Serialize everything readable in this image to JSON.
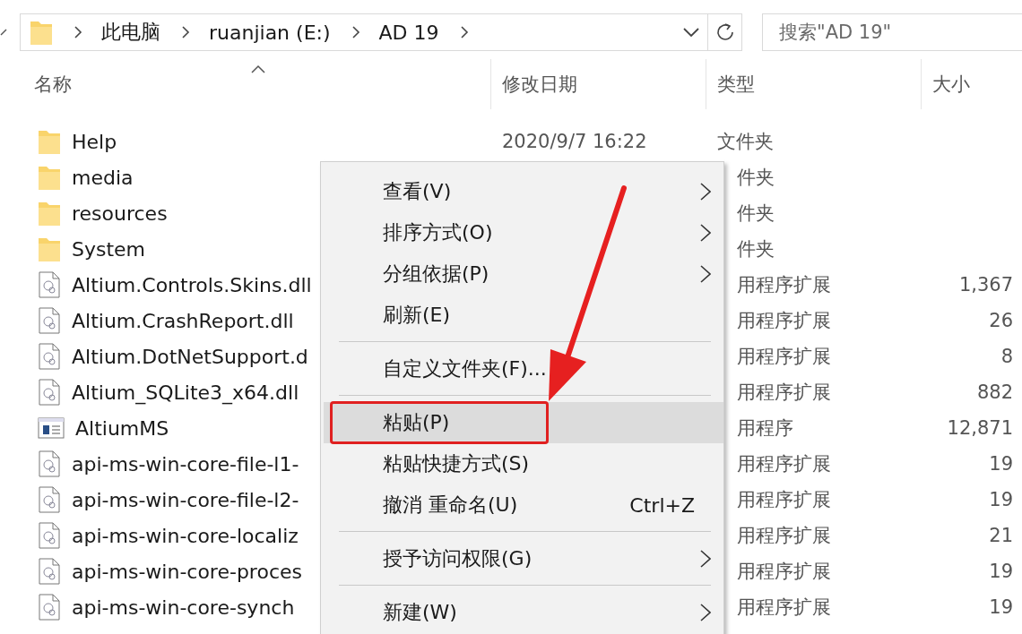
{
  "address_bar": {
    "path": [
      "此电脑",
      "ruanjian (E:)",
      "AD 19"
    ]
  },
  "search": {
    "placeholder": "搜索\"AD 19\""
  },
  "columns": [
    {
      "label": "名称",
      "sorted": true
    },
    {
      "label": "修改日期",
      "sorted": false
    },
    {
      "label": "类型",
      "sorted": false
    },
    {
      "label": "大小",
      "sorted": false
    }
  ],
  "files": [
    {
      "kind": "folder",
      "name": "Help",
      "date": "2020/9/7 16:22",
      "type": "文件夹",
      "type_partly_covered": false
    },
    {
      "kind": "folder",
      "name": "media",
      "type": "件夹",
      "type_partly_covered": true
    },
    {
      "kind": "folder",
      "name": "resources",
      "type": "件夹",
      "type_partly_covered": true
    },
    {
      "kind": "folder",
      "name": "System",
      "type": "件夹",
      "type_partly_covered": true
    },
    {
      "kind": "dll",
      "name": "Altium.Controls.Skins.dll",
      "type": "用程序扩展",
      "type_partly_covered": true,
      "size": "1,367"
    },
    {
      "kind": "dll",
      "name": "Altium.CrashReport.dll",
      "type": "用程序扩展",
      "type_partly_covered": true,
      "size": "26"
    },
    {
      "kind": "dll",
      "name": "Altium.DotNetSupport.d",
      "type": "用程序扩展",
      "type_partly_covered": true,
      "size": "8"
    },
    {
      "kind": "dll",
      "name": "Altium_SQLite3_x64.dll",
      "type": "用程序扩展",
      "type_partly_covered": true,
      "size": "882"
    },
    {
      "kind": "app",
      "name": "AltiumMS",
      "type": "用程序",
      "type_partly_covered": true,
      "size": "12,871"
    },
    {
      "kind": "dll",
      "name": "api-ms-win-core-file-l1-",
      "type": "用程序扩展",
      "type_partly_covered": true,
      "size": "19"
    },
    {
      "kind": "dll",
      "name": "api-ms-win-core-file-l2-",
      "type": "用程序扩展",
      "type_partly_covered": true,
      "size": "19"
    },
    {
      "kind": "dll",
      "name": "api-ms-win-core-localiz",
      "type": "用程序扩展",
      "type_partly_covered": true,
      "size": "21"
    },
    {
      "kind": "dll",
      "name": "api-ms-win-core-proces",
      "type": "用程序扩展",
      "type_partly_covered": true,
      "size": "19"
    },
    {
      "kind": "dll",
      "name": "api-ms-win-core-synch",
      "type": "用程序扩展",
      "type_partly_covered": true,
      "size": "19"
    }
  ],
  "context_menu": [
    {
      "kind": "item",
      "label": "查看(V)",
      "submenu": true,
      "selected": false,
      "annotated": false
    },
    {
      "kind": "item",
      "label": "排序方式(O)",
      "submenu": true,
      "selected": false,
      "annotated": false
    },
    {
      "kind": "item",
      "label": "分组依据(P)",
      "submenu": true,
      "selected": false,
      "annotated": false
    },
    {
      "kind": "item",
      "label": "刷新(E)",
      "submenu": false,
      "selected": false,
      "annotated": false
    },
    {
      "kind": "separator"
    },
    {
      "kind": "item",
      "label": "自定义文件夹(F)...",
      "submenu": false,
      "selected": false,
      "annotated": false
    },
    {
      "kind": "separator"
    },
    {
      "kind": "item",
      "label": "粘贴(P)",
      "submenu": false,
      "selected": true,
      "annotated": true
    },
    {
      "kind": "item",
      "label": "粘贴快捷方式(S)",
      "submenu": false,
      "selected": false,
      "annotated": false
    },
    {
      "kind": "item",
      "label": "撤消 重命名(U)",
      "shortcut": "Ctrl+Z",
      "submenu": false,
      "selected": false,
      "annotated": false
    },
    {
      "kind": "separator"
    },
    {
      "kind": "item",
      "label": "授予访问权限(G)",
      "submenu": true,
      "selected": false,
      "annotated": false
    },
    {
      "kind": "separator"
    },
    {
      "kind": "item",
      "label": "新建(W)",
      "submenu": true,
      "selected": false,
      "annotated": false
    }
  ]
}
